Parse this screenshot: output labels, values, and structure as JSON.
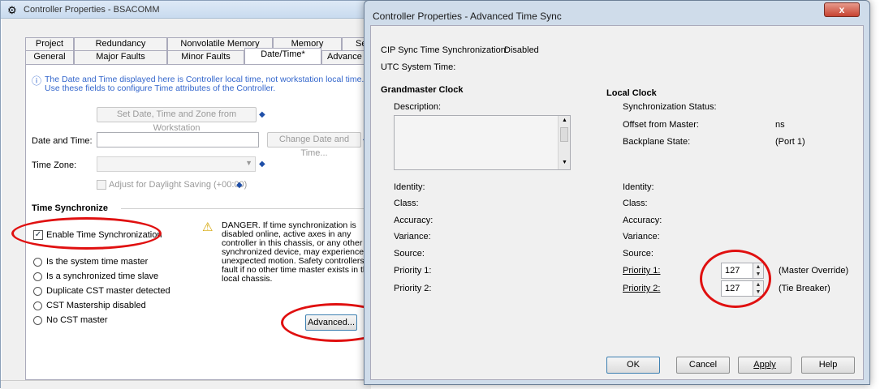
{
  "left_window": {
    "title": "Controller Properties - BSACOMM",
    "tabs_row1": [
      "Project",
      "Redundancy",
      "Nonvolatile Memory",
      "Memory",
      "Se"
    ],
    "tabs_row2": [
      "General",
      "Major Faults",
      "Minor Faults",
      "Date/Time*",
      "Advance"
    ],
    "info_line1": "The Date and Time displayed here is Controller local time, not workstation local time.",
    "info_line2": "Use these fields to configure Time attributes of the Controller.",
    "set_from_workstation_button": "Set Date, Time and Zone from Workstation",
    "date_time_label": "Date and Time:",
    "date_time_value": "",
    "change_date_time_button": "Change Date and Time...",
    "time_zone_label": "Time Zone:",
    "time_zone_value": "",
    "daylight_saving_label": "Adjust for Daylight Saving (+00:00)",
    "time_sync_heading": "Time Synchronize",
    "enable_sync_label": "Enable Time Synchronization",
    "radio_options": [
      "Is the system time master",
      "Is a synchronized time slave",
      "Duplicate CST master detected",
      "CST Mastership disabled",
      "No CST master"
    ],
    "danger_text": [
      "DANGER. If time synchronization is",
      "disabled online, active axes in any",
      "controller in this chassis, or any other",
      "synchronized device, may experience",
      "unexpected motion.  Safety controllers ma",
      "fault if no other time master exists in the",
      "local chassis."
    ],
    "advanced_button": "Advanced..."
  },
  "right_window": {
    "title": "Controller Properties - Advanced Time Sync",
    "close_label": "x",
    "cip_sync_label": "CIP Sync Time Synchronization:",
    "cip_sync_value": "Disabled",
    "utc_label": "UTC System Time:",
    "grandmaster": {
      "heading": "Grandmaster Clock",
      "description_label": "Description:",
      "fields": [
        "Identity:",
        "Class:",
        "Accuracy:",
        "Variance:",
        "Source:",
        "Priority 1:",
        "Priority 2:"
      ]
    },
    "local": {
      "heading": "Local Clock",
      "sync_status_label": "Synchronization Status:",
      "offset_label": "Offset from Master:",
      "offset_unit": "ns",
      "backplane_label": "Backplane State:",
      "backplane_value": "(Port 1)",
      "fields": [
        "Identity:",
        "Class:",
        "Accuracy:",
        "Variance:",
        "Source:"
      ],
      "priority1_label": "Priority 1:",
      "priority1_value": "127",
      "priority1_note": "(Master Override)",
      "priority2_label": "Priority 2:",
      "priority2_value": "127",
      "priority2_note": "(Tie Breaker)"
    },
    "buttons": {
      "ok": "OK",
      "cancel": "Cancel",
      "apply": "Apply",
      "help": "Help"
    }
  }
}
